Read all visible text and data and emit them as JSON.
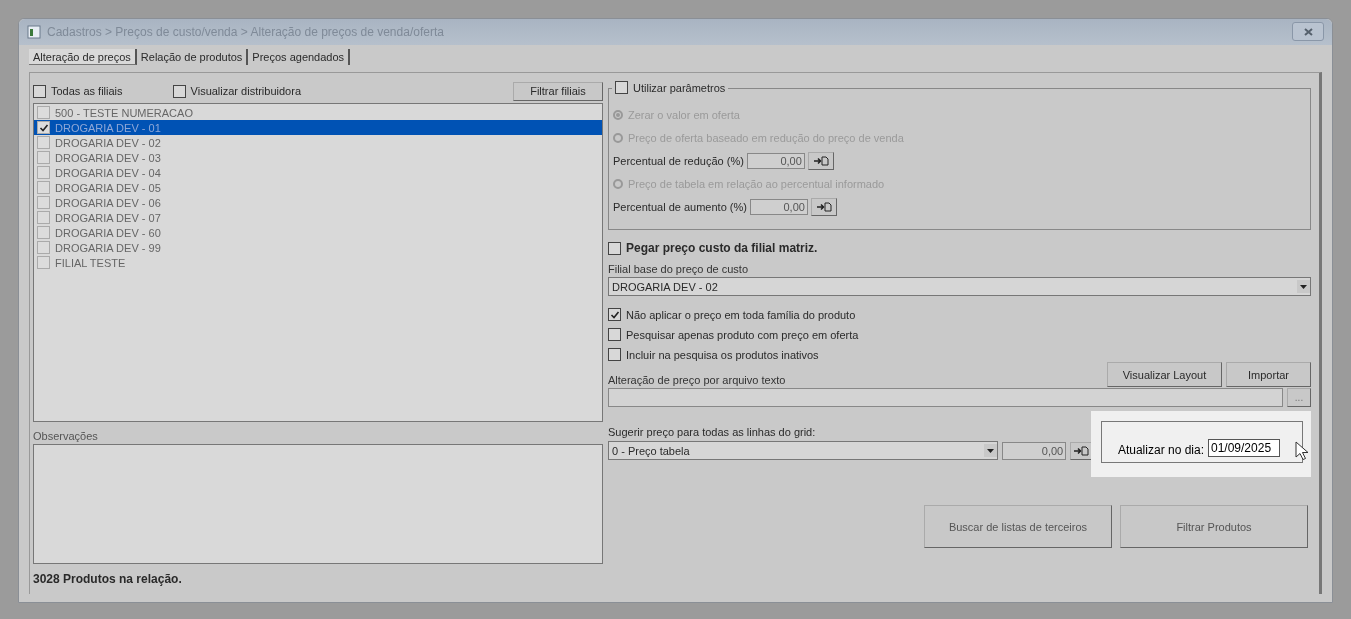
{
  "window": {
    "title": "Cadastros > Preços de custo/venda > Alteração de preços de venda/oferta"
  },
  "tabs": [
    {
      "label": "Alteração de preços",
      "selected": true
    },
    {
      "label": "Relação de produtos",
      "selected": false
    },
    {
      "label": "Preços agendados",
      "selected": false
    }
  ],
  "branches": {
    "all_checkbox": {
      "label": "Todas as filiais",
      "checked": false
    },
    "distributor_checkbox": {
      "label": "Visualizar distribuidora",
      "checked": false
    },
    "filter_button": "Filtrar filiais",
    "items": [
      {
        "label": "500 - TESTE NUMERACAO",
        "checked": false,
        "selected": false
      },
      {
        "label": "DROGARIA DEV - 01",
        "checked": true,
        "selected": true
      },
      {
        "label": "DROGARIA DEV - 02",
        "checked": false,
        "selected": false
      },
      {
        "label": "DROGARIA DEV - 03",
        "checked": false,
        "selected": false
      },
      {
        "label": "DROGARIA DEV - 04",
        "checked": false,
        "selected": false
      },
      {
        "label": "DROGARIA DEV - 05",
        "checked": false,
        "selected": false
      },
      {
        "label": "DROGARIA DEV - 06",
        "checked": false,
        "selected": false
      },
      {
        "label": "DROGARIA DEV - 07",
        "checked": false,
        "selected": false
      },
      {
        "label": "DROGARIA DEV - 60",
        "checked": false,
        "selected": false
      },
      {
        "label": "DROGARIA DEV - 99",
        "checked": false,
        "selected": false
      },
      {
        "label": "FILIAL TESTE",
        "checked": false,
        "selected": false
      }
    ]
  },
  "observations": {
    "label": "Observações"
  },
  "status": "3028 Produtos na relação.",
  "parameters": {
    "label": "Utilizar parâmetros",
    "checked": false,
    "rows": [
      {
        "kind": "radio",
        "label": "Zerar o valor em oferta",
        "selected": true,
        "disabled": true
      },
      {
        "kind": "radio",
        "label": "Preço de oferta baseado em redução do preço de venda",
        "selected": false,
        "disabled": true
      },
      {
        "kind": "field",
        "label": "Percentual de redução (%)",
        "value": "0,00"
      },
      {
        "kind": "radio",
        "label": "Preço de tabela em relação ao percentual informado",
        "selected": false,
        "disabled": true
      },
      {
        "kind": "field",
        "label": "Percentual de aumento (%)",
        "value": "0,00"
      }
    ]
  },
  "matrix_cost": {
    "label": "Pegar preço custo da filial matriz.",
    "checked": false
  },
  "cost_base": {
    "label": "Filial base do preço de custo",
    "value": "DROGARIA DEV - 02"
  },
  "options": [
    {
      "label": "Não aplicar o preço em toda família do produto",
      "checked": true
    },
    {
      "label": "Pesquisar apenas produto com preço em oferta",
      "checked": false
    },
    {
      "label": "Incluir na pesquisa os produtos inativos",
      "checked": false
    }
  ],
  "layout_buttons": [
    "Visualizar Layout",
    "Importar"
  ],
  "text_file": {
    "label": "Alteração de preço por arquivo texto",
    "browse": "..."
  },
  "suggest": {
    "label": "Sugerir preço para todas as linhas do grid:",
    "value": "0 - Preço tabela",
    "amount": "0,00"
  },
  "update_date": {
    "label": "Atualizar no dia:",
    "value": "01/09/2025"
  },
  "action_buttons": [
    "Buscar de listas de terceiros",
    "Filtrar Produtos"
  ]
}
